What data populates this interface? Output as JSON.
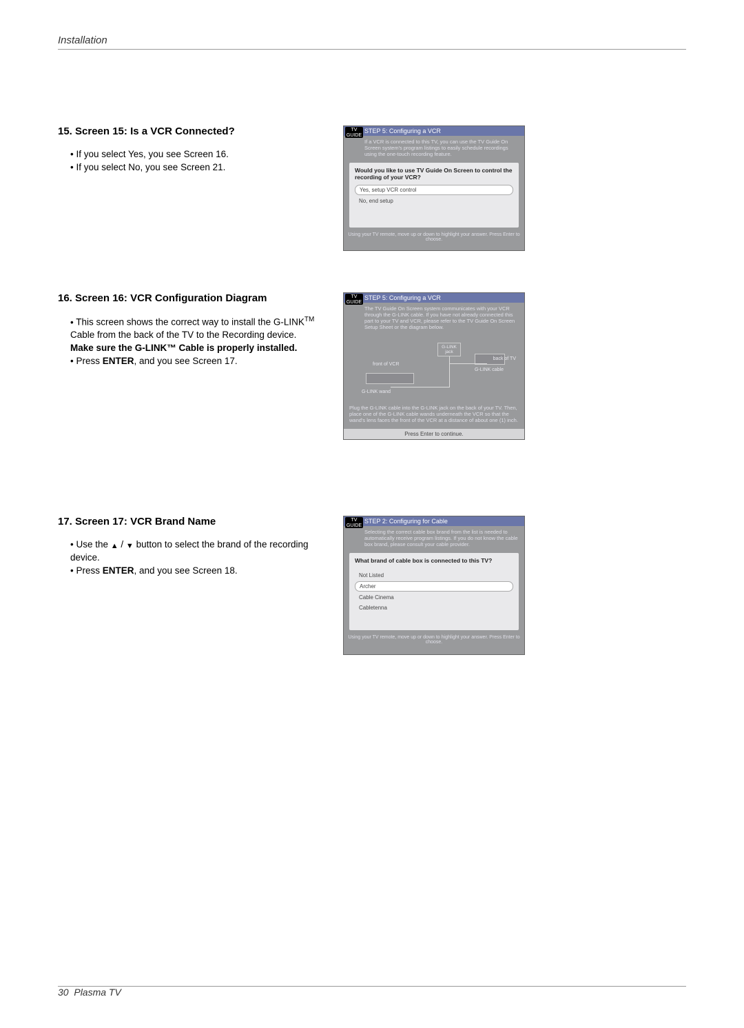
{
  "header": {
    "title": "Installation"
  },
  "footer": {
    "page_number": "30",
    "product": "Plasma TV"
  },
  "sections": {
    "s15": {
      "heading": "15. Screen 15: Is a VCR Connected?",
      "bullets": [
        "If you select Yes, you see Screen 16.",
        "If you select No, you see Screen 21."
      ],
      "box": {
        "logo_top": "TV",
        "logo_bottom": "GUIDE",
        "title": "STEP 5: Configuring a VCR",
        "intro": "If a VCR is connected to this TV, you can use the TV Guide On Screen system's program listings to easily schedule recordings using the one-touch recording feature.",
        "question": "Would you like to use TV Guide On Screen to control the recording of your VCR?",
        "options": [
          {
            "label": "Yes, setup VCR control",
            "selected": true
          },
          {
            "label": "No, end setup",
            "selected": false
          }
        ],
        "footer": "Using your TV remote, move up or down to highlight your answer.  Press Enter to choose."
      }
    },
    "s16": {
      "heading": "16. Screen 16: VCR Configuration Diagram",
      "bullet_pre": "This screen shows the correct way to install the G-LINK",
      "tm": "TM",
      "bullet_post": " Cable from the back of the TV to the Recording device.",
      "note": "Make sure the G-LINK™ Cable is properly installed.",
      "bullet2_pre": "Press ",
      "bullet2_bold": "ENTER",
      "bullet2_post": ", and you see Screen 17.",
      "box": {
        "logo_top": "TV",
        "logo_bottom": "GUIDE",
        "title": "STEP 5: Configuring a VCR",
        "intro": "The TV Guide On Screen system communicates with your VCR through the G-LINK cable. If you have not already connected this part to your TV and VCR, please refer to the TV Guide On Screen Setup Sheet or the diagram below.",
        "labels": {
          "glink_jack": "G-LINK jack",
          "front_vcr": "front of VCR",
          "back_tv": "back of TV",
          "glink_cable": "G-LINK cable",
          "glink_wand": "G-LINK wand"
        },
        "caption": "Plug the G-LINK cable into the G-LINK jack on the back of your TV. Then, place one of the G-LINK cable wands underneath the VCR so that the wand's lens faces the front of the VCR at a distance of about one (1) inch.",
        "continue": "Press Enter to continue."
      }
    },
    "s17": {
      "heading": "17. Screen 17: VCR Brand Name",
      "bullet1_pre": "Use the ",
      "bullet1_mid": " / ",
      "bullet1_post": " button to select the brand of the recording device.",
      "bullet2_pre": "Press ",
      "bullet2_bold": "ENTER",
      "bullet2_post": ", and you see Screen 18.",
      "box": {
        "logo_top": "TV",
        "logo_bottom": "GUIDE",
        "title": "STEP 2: Configuring for Cable",
        "intro": "Selecting the correct cable box brand from the list is needed to automatically receive program listings. If you do not know the cable box brand, please consult your cable provider.",
        "question": "What brand of cable box is connected to this TV?",
        "options": [
          {
            "label": "Not Listed",
            "selected": false
          },
          {
            "label": "Archer",
            "selected": true
          },
          {
            "label": "Cable Cinema",
            "selected": false
          },
          {
            "label": "Cabletenna",
            "selected": false
          }
        ],
        "footer": "Using your TV remote, move up or down to highlight your answer.  Press Enter to choose."
      }
    }
  }
}
